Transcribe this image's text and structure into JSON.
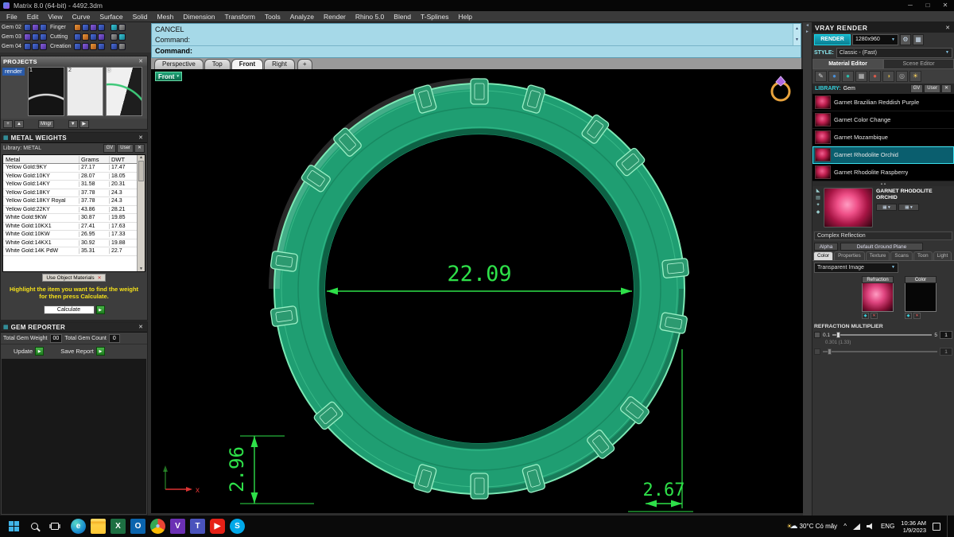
{
  "titlebar": {
    "title": "Matrix 8.0 (64-bit) - 4492.3dm",
    "minimize": "─",
    "maximize": "□",
    "close": "✕"
  },
  "menubar": {
    "items": [
      "File",
      "Edit",
      "View",
      "Curve",
      "Surface",
      "Solid",
      "Mesh",
      "Dimension",
      "Transform",
      "Tools",
      "Analyze",
      "Render",
      "Rhino 5.0",
      "Blend",
      "T-Splines",
      "Help"
    ]
  },
  "gem_toolbar": {
    "rows": [
      {
        "left_label": "Gem 02",
        "right_label": "Finger"
      },
      {
        "left_label": "Gem 03",
        "right_label": "Cutting"
      },
      {
        "left_label": "Gem 04",
        "right_label": "Creation"
      }
    ]
  },
  "projects": {
    "title": "PROJECTS",
    "active_item": "render",
    "thumbnails": [
      {
        "number": "1"
      },
      {
        "number": "2"
      },
      {
        "number": "3"
      }
    ],
    "footer_buttons": [
      "+",
      "▲",
      "Mngr",
      "▼",
      "▶"
    ]
  },
  "metal_weights": {
    "title": "METAL WEIGHTS",
    "library_label": "Library:  METAL",
    "library_buttons": [
      "GV",
      "User",
      "✕"
    ],
    "columns": [
      "Metal",
      "Grams",
      "DWT"
    ],
    "rows": [
      {
        "metal": "Yellow Gold:9KY",
        "grams": "27.17",
        "dwt": "17.47"
      },
      {
        "metal": "Yellow Gold:10KY",
        "grams": "28.07",
        "dwt": "18.05"
      },
      {
        "metal": "Yellow Gold:14KY",
        "grams": "31.58",
        "dwt": "20.31"
      },
      {
        "metal": "Yellow Gold:18KY",
        "grams": "37.78",
        "dwt": "24.3"
      },
      {
        "metal": "Yellow Gold:18KY Royal",
        "grams": "37.78",
        "dwt": "24.3"
      },
      {
        "metal": "Yellow Gold:22KY",
        "grams": "43.86",
        "dwt": "28.21"
      },
      {
        "metal": "White Gold:9KW",
        "grams": "30.87",
        "dwt": "19.85"
      },
      {
        "metal": "White Gold:10KX1",
        "grams": "27.41",
        "dwt": "17.63"
      },
      {
        "metal": "White Gold:10KW",
        "grams": "26.95",
        "dwt": "17.33"
      },
      {
        "metal": "White Gold:14KX1",
        "grams": "30.92",
        "dwt": "19.88"
      },
      {
        "metal": "White Gold:14K PdW",
        "grams": "35.31",
        "dwt": "22.7"
      }
    ],
    "use_materials_button": "Use Object Materials",
    "hint_line1": "Highlight the item you want to find the weight",
    "hint_line2": "for then press Calculate.",
    "calculate_button": "Calculate"
  },
  "gem_reporter": {
    "title": "GEM REPORTER",
    "weight_label": "Total Gem Weight",
    "weight_value": "00",
    "count_label": "Total Gem Count",
    "count_value": "0",
    "update_button": "Update",
    "save_button": "Save Report"
  },
  "command": {
    "history": [
      "CANCEL",
      "Command:"
    ],
    "prompt_label": "Command:"
  },
  "view_tabs": {
    "tabs": [
      {
        "label": "Perspective"
      },
      {
        "label": "Top"
      },
      {
        "label": "Front",
        "selected": true
      },
      {
        "label": "Right"
      }
    ],
    "new_tab": "+"
  },
  "viewport": {
    "view_label": "Front",
    "dropdown_arrow": "▾",
    "dimensions": {
      "width": "22.09",
      "left_height": "2.96",
      "right_height": "2.67"
    },
    "axis_label": "x",
    "ring": {
      "gem_angles": [
        254,
        270,
        286,
        214,
        228,
        172,
        188,
        140,
        74,
        90,
        106,
        38,
        52,
        354,
        10,
        306,
        320
      ],
      "fill": "#1f9e72",
      "edge": "#7be8b4",
      "dimension_color": "#2ee049"
    }
  },
  "vray": {
    "title": "VRAY RENDER",
    "render_button": "RENDER",
    "resolution": "1280x960",
    "style_label": "STYLE:",
    "style_value": "Classic - (Fast)",
    "editor_tabs": [
      "Material Editor",
      "Scene Editor"
    ],
    "toolbar_icons": [
      {
        "name": "edit-material-icon",
        "glyph": "✎",
        "color": "#d8d8d8"
      },
      {
        "name": "sphere-blue-icon",
        "glyph": "●",
        "color": "#4a90d9"
      },
      {
        "name": "sphere-teal-icon",
        "glyph": "●",
        "color": "#2abfae"
      },
      {
        "name": "checker-icon",
        "glyph": "▦",
        "color": "#c8c8c8"
      },
      {
        "name": "sphere-red-icon",
        "glyph": "●",
        "color": "#d95a4a"
      },
      {
        "name": "paint-icon",
        "glyph": "◑",
        "color": "#cfae4a"
      },
      {
        "name": "sphere-gray-icon",
        "gly­ph": "◎",
        "glyph": "◎",
        "color": "#b0b0b0"
      },
      {
        "name": "light-icon",
        "glyph": "☀",
        "color": "#ffd35c"
      }
    ],
    "library_label": "LIBRARY:",
    "library_value": "Gem",
    "library_buttons": [
      "GV",
      "User",
      "✕"
    ],
    "materials": [
      {
        "name": "Garnet Brazilian Reddish Purple"
      },
      {
        "name": "Garnet Color Change"
      },
      {
        "name": "Garnet Mozambique"
      },
      {
        "name": "Garnet Rhodolite Orchid",
        "selected": true
      },
      {
        "name": "Garnet Rhodolite Raspberry"
      }
    ],
    "preview_title": "GARNET RHODOLITE ORCHID",
    "reflection_label": "Complex Reflection",
    "alpha_label": "Alpha",
    "ground_label": "Default Ground Plane",
    "property_tabs": [
      {
        "label": "Color",
        "selected": true
      },
      {
        "label": "Properties"
      },
      {
        "label": "Texture"
      },
      {
        "label": "Scans"
      },
      {
        "label": "Toon"
      },
      {
        "label": "Light"
      }
    ],
    "transparent_dropdown": "Transparent Image",
    "swatches": [
      {
        "label": "Refraction"
      },
      {
        "label": "Color"
      }
    ],
    "refraction_multiplier_label": "REFRACTION MULTIPLIER",
    "slider": {
      "min": "0.1",
      "max": "5",
      "value": "1",
      "sub_text": "0.301 (1.33)",
      "value2": "1"
    }
  },
  "taskbar": {
    "weather": "30°C Có mây",
    "caret": "^",
    "lang": "ENG",
    "time": "10:36 AM",
    "date": "1/9/2023",
    "icons": [
      {
        "name": "edge-icon",
        "glyph": "e",
        "bg": "radial-gradient(circle at 35% 30%, #59d9c5, #1b8fd0 60%, #0a57a0)",
        "fg": "#ffffff",
        "radius": "50%"
      },
      {
        "name": "file-explorer-icon",
        "glyph": "",
        "bg": "linear-gradient(#ffd75e 18%, #f0a81f 18%, #ffcf44 40%, #ffc835)",
        "fg": "#7a5200",
        "radius": "2px"
      },
      {
        "name": "excel-icon",
        "glyph": "X",
        "bg": "#1d6f42",
        "fg": "#ffffff",
        "radius": "2px"
      },
      {
        "name": "outlook-icon",
        "glyph": "O",
        "bg": "#0a64ad",
        "fg": "#ffffff",
        "radius": "2px"
      },
      {
        "name": "chrome-icon",
        "glyph": "●",
        "bg": "conic-gradient(#ea4335 0 120deg, #fbbc05 120deg 240deg, #34a853 240deg 360deg)",
        "fg": "#a8c7fa",
        "radius": "50%"
      },
      {
        "name": "app-purple-icon",
        "glyph": "V",
        "bg": "#6b30b4",
        "fg": "#ffffff",
        "radius": "2px"
      },
      {
        "name": "teams-icon",
        "glyph": "T",
        "bg": "#4a53bc",
        "fg": "#ffffff",
        "radius": "2px"
      },
      {
        "name": "youtube-icon",
        "glyph": "▶",
        "bg": "#e62117",
        "fg": "#ffffff",
        "radius": "4px"
      },
      {
        "name": "skype-icon",
        "glyph": "S",
        "bg": "#00a8e8",
        "fg": "#ffffff",
        "radius": "50%"
      }
    ]
  }
}
